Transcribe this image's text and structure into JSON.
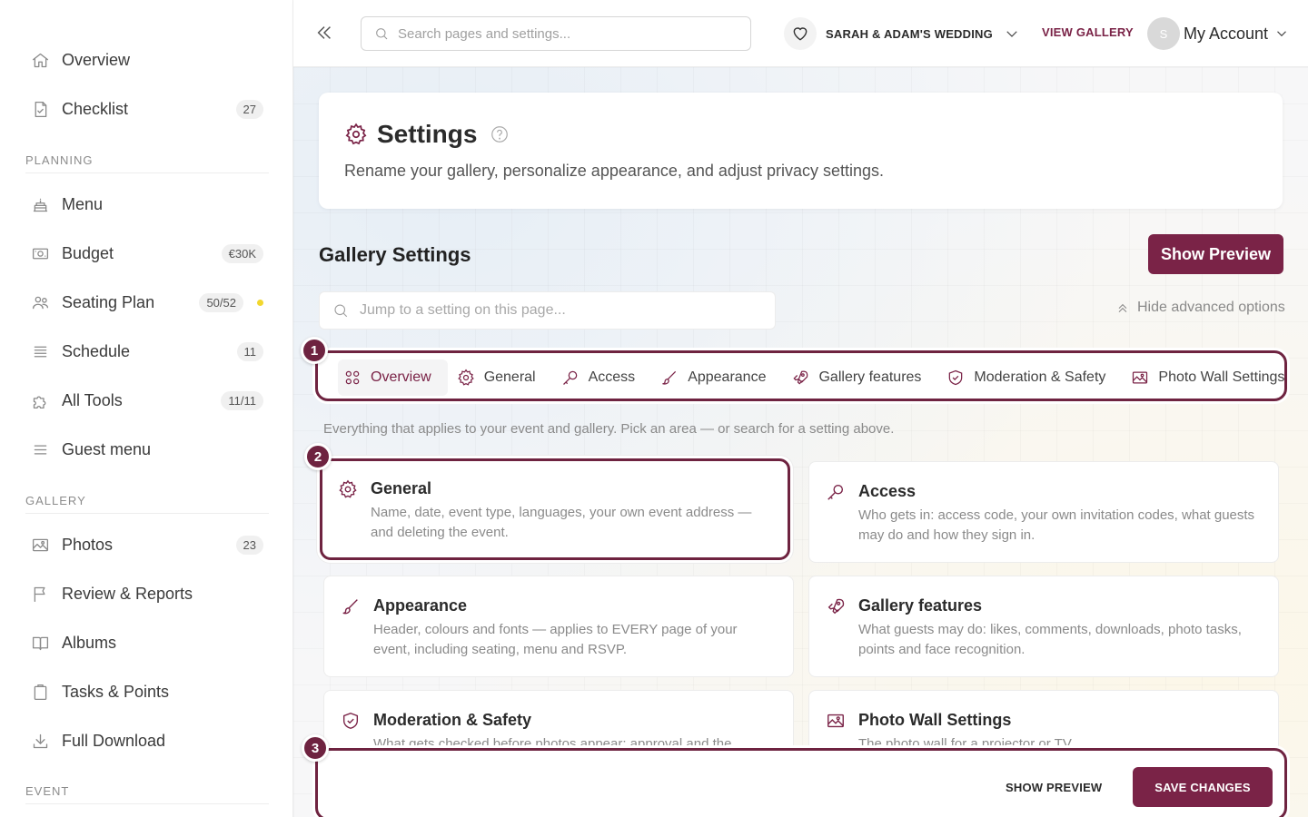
{
  "sidebar": {
    "items": [
      {
        "label": "Overview",
        "icon": "home-icon"
      },
      {
        "label": "Checklist",
        "icon": "checklist-icon",
        "badge": "27"
      },
      {
        "label": "Menu",
        "icon": "cake-icon"
      },
      {
        "label": "Budget",
        "icon": "money-icon",
        "badge": "€30K"
      },
      {
        "label": "Seating Plan",
        "icon": "people-icon",
        "badge": "50/52",
        "dot_color": "#f2d72e"
      },
      {
        "label": "Schedule",
        "icon": "list-icon",
        "badge": "11"
      },
      {
        "label": "All Tools",
        "icon": "puzzle-icon",
        "badge": "11/11"
      },
      {
        "label": "Guest menu",
        "icon": "menu-icon"
      },
      {
        "label": "Photos",
        "icon": "image-icon",
        "badge": "23"
      },
      {
        "label": "Review & Reports",
        "icon": "flag-icon"
      },
      {
        "label": "Albums",
        "icon": "book-icon"
      },
      {
        "label": "Tasks & Points",
        "icon": "clipboard-icon"
      },
      {
        "label": "Full Download",
        "icon": "download-icon"
      }
    ],
    "sections": {
      "planning": "PLANNING",
      "gallery": "GALLERY",
      "event": "EVENT"
    }
  },
  "topbar": {
    "search_placeholder": "Search pages and settings...",
    "event_name": "SARAH & ADAM'S WEDDING",
    "view_gallery": "VIEW GALLERY",
    "avatar_initial": "S",
    "account_label": "My Account"
  },
  "header": {
    "title": "Settings",
    "description": "Rename your gallery, personalize appearance, and adjust privacy settings."
  },
  "gallery_settings": {
    "title": "Gallery Settings",
    "show_preview": "Show Preview",
    "jump_placeholder": "Jump to a setting on this page...",
    "hide_advanced": "Hide advanced options",
    "intro": "Everything that applies to your event and gallery. Pick an area — or search for a setting above."
  },
  "tabs": [
    {
      "label": "Overview",
      "icon": "grid-icon",
      "active": true
    },
    {
      "label": "General",
      "icon": "gear-icon"
    },
    {
      "label": "Access",
      "icon": "key-icon"
    },
    {
      "label": "Appearance",
      "icon": "brush-icon"
    },
    {
      "label": "Gallery features",
      "icon": "rocket-icon"
    },
    {
      "label": "Moderation & Safety",
      "icon": "shield-icon"
    },
    {
      "label": "Photo Wall Settings",
      "icon": "image-icon"
    }
  ],
  "cards": [
    {
      "title": "General",
      "icon": "gear-icon",
      "desc": "Name, date, event type, languages, your own event address — and deleting the event."
    },
    {
      "title": "Access",
      "icon": "key-icon",
      "desc": "Who gets in: access code, your own invitation codes, what guests may do and how they sign in."
    },
    {
      "title": "Appearance",
      "icon": "brush-icon",
      "desc": "Header, colours and fonts — applies to EVERY page of your event, including seating, menu and RSVP."
    },
    {
      "title": "Gallery features",
      "icon": "rocket-icon",
      "desc": "What guests may do: likes, comments, downloads, photo tasks, points and face recognition."
    },
    {
      "title": "Moderation & Safety",
      "icon": "shield-icon",
      "desc": "What gets checked before photos appear: approval and the"
    },
    {
      "title": "Photo Wall Settings",
      "icon": "image-icon",
      "desc": "The photo wall for a projector or TV."
    }
  ],
  "save_bar": {
    "show_preview": "SHOW PREVIEW",
    "save": "SAVE CHANGES"
  },
  "markers": [
    "1",
    "2",
    "3"
  ],
  "colors": {
    "brand": "#7a2347",
    "annotation": "#6e2340",
    "dot": "#f2d72e"
  }
}
